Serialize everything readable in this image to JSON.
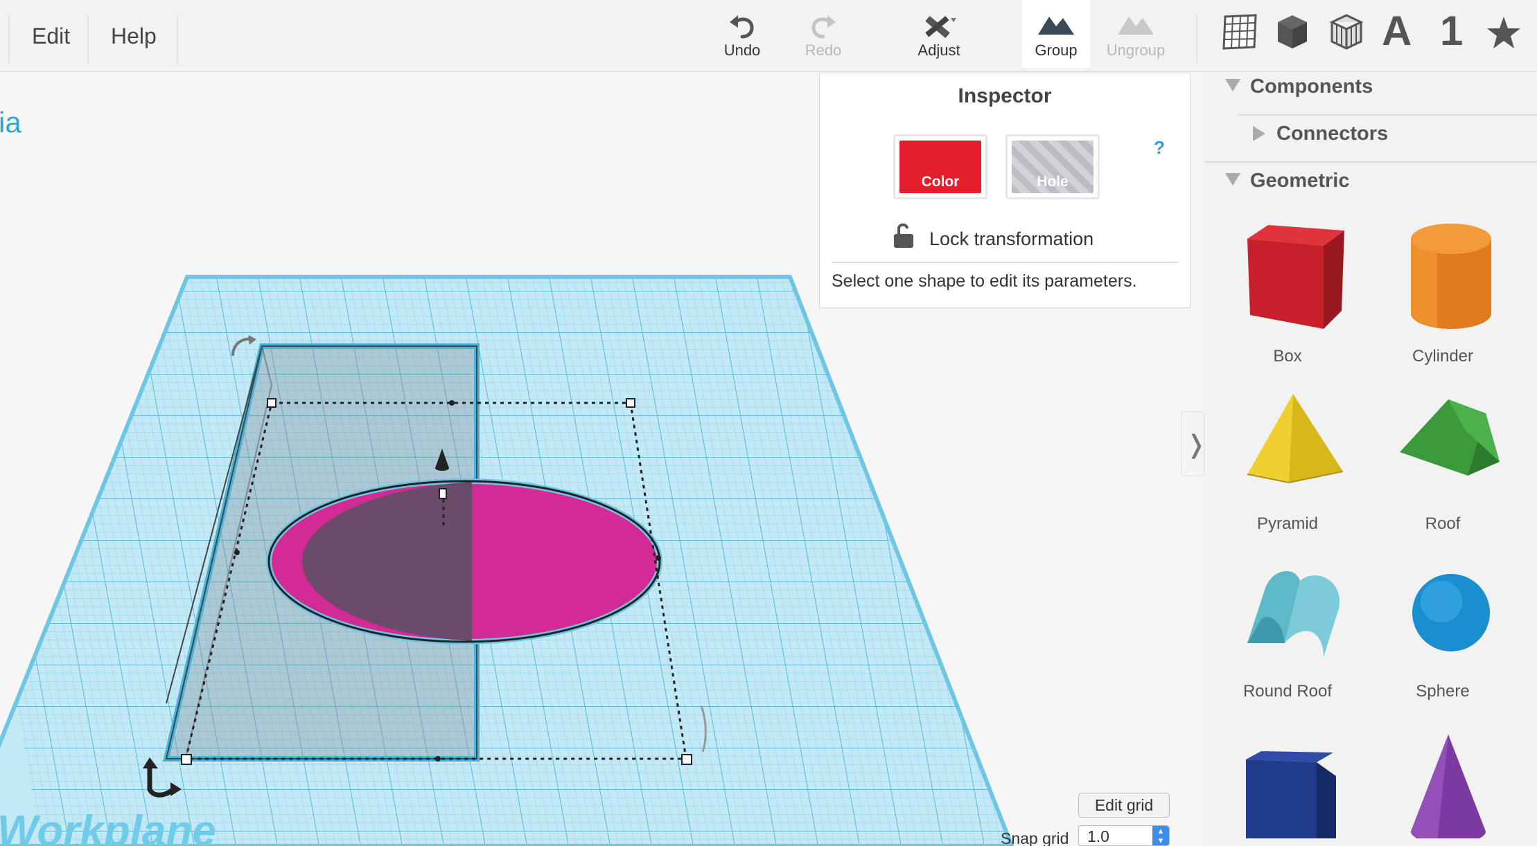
{
  "menu": {
    "edit": "Edit",
    "help": "Help"
  },
  "toolbar": {
    "undo": "Undo",
    "redo": "Redo",
    "adjust": "Adjust",
    "group": "Group",
    "ungroup": "Ungroup",
    "view_icons": [
      "grid-view-icon",
      "box-view-icon",
      "wire-box-icon",
      "text-A-icon",
      "number-1-icon",
      "star-icon"
    ],
    "view_text": {
      "letter": "A",
      "number": "1"
    }
  },
  "project": {
    "name_fragment": "ia"
  },
  "inspector": {
    "title": "Inspector",
    "color_label": "Color",
    "hole_label": "Hole",
    "help": "?",
    "lock_label": "Lock transformation",
    "message": "Select one shape to edit its parameters.",
    "color_value": "#e51e2d"
  },
  "canvas": {
    "workplane_label": "Workplane"
  },
  "controls": {
    "edit_grid": "Edit grid",
    "snap_label": "Snap grid",
    "snap_value": "1.0"
  },
  "library": {
    "components": "Components",
    "connectors": "Connectors",
    "geometric": "Geometric",
    "shapes": [
      {
        "label": "Box",
        "color": "#c8202a"
      },
      {
        "label": "Cylinder",
        "color": "#e07a1c"
      },
      {
        "label": "Pyramid",
        "color": "#ecc521"
      },
      {
        "label": "Roof",
        "color": "#3a9a3a"
      },
      {
        "label": "Round Roof",
        "color": "#5db8c8"
      },
      {
        "label": "Sphere",
        "color": "#1a8fd0"
      },
      {
        "label": "Wedge",
        "color": "#203b8c"
      },
      {
        "label": "Cone",
        "color": "#7b3aa0"
      }
    ]
  },
  "colors": {
    "accent": "#2aa8cf",
    "ellipse": "#d42a95"
  }
}
